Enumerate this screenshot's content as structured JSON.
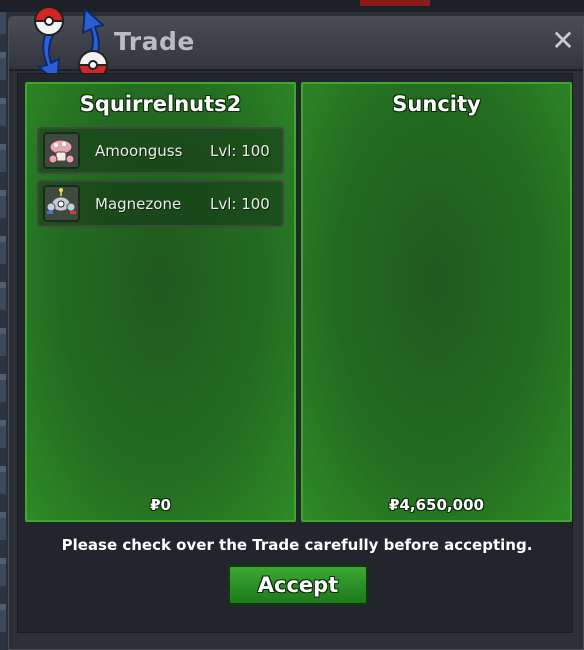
{
  "window": {
    "title": "Trade",
    "close_glyph": "✕",
    "notice": "Please check over the Trade carefully before accepting.",
    "accept_label": "Accept"
  },
  "left_panel": {
    "player": "Squirrelnuts2",
    "money": "₽0",
    "pokemon": [
      {
        "name": "Amoonguss",
        "level": "Lvl: 100",
        "icon": "amoonguss-icon"
      },
      {
        "name": "Magnezone",
        "level": "Lvl: 100",
        "icon": "magnezone-icon"
      }
    ]
  },
  "right_panel": {
    "player": "Suncity",
    "money": "₽4,650,000",
    "pokemon": []
  },
  "colors": {
    "panel_green": "#236b21",
    "panel_border": "#3fa62e",
    "accept_green": "#2e8f27",
    "window_bg": "#2e3038"
  }
}
